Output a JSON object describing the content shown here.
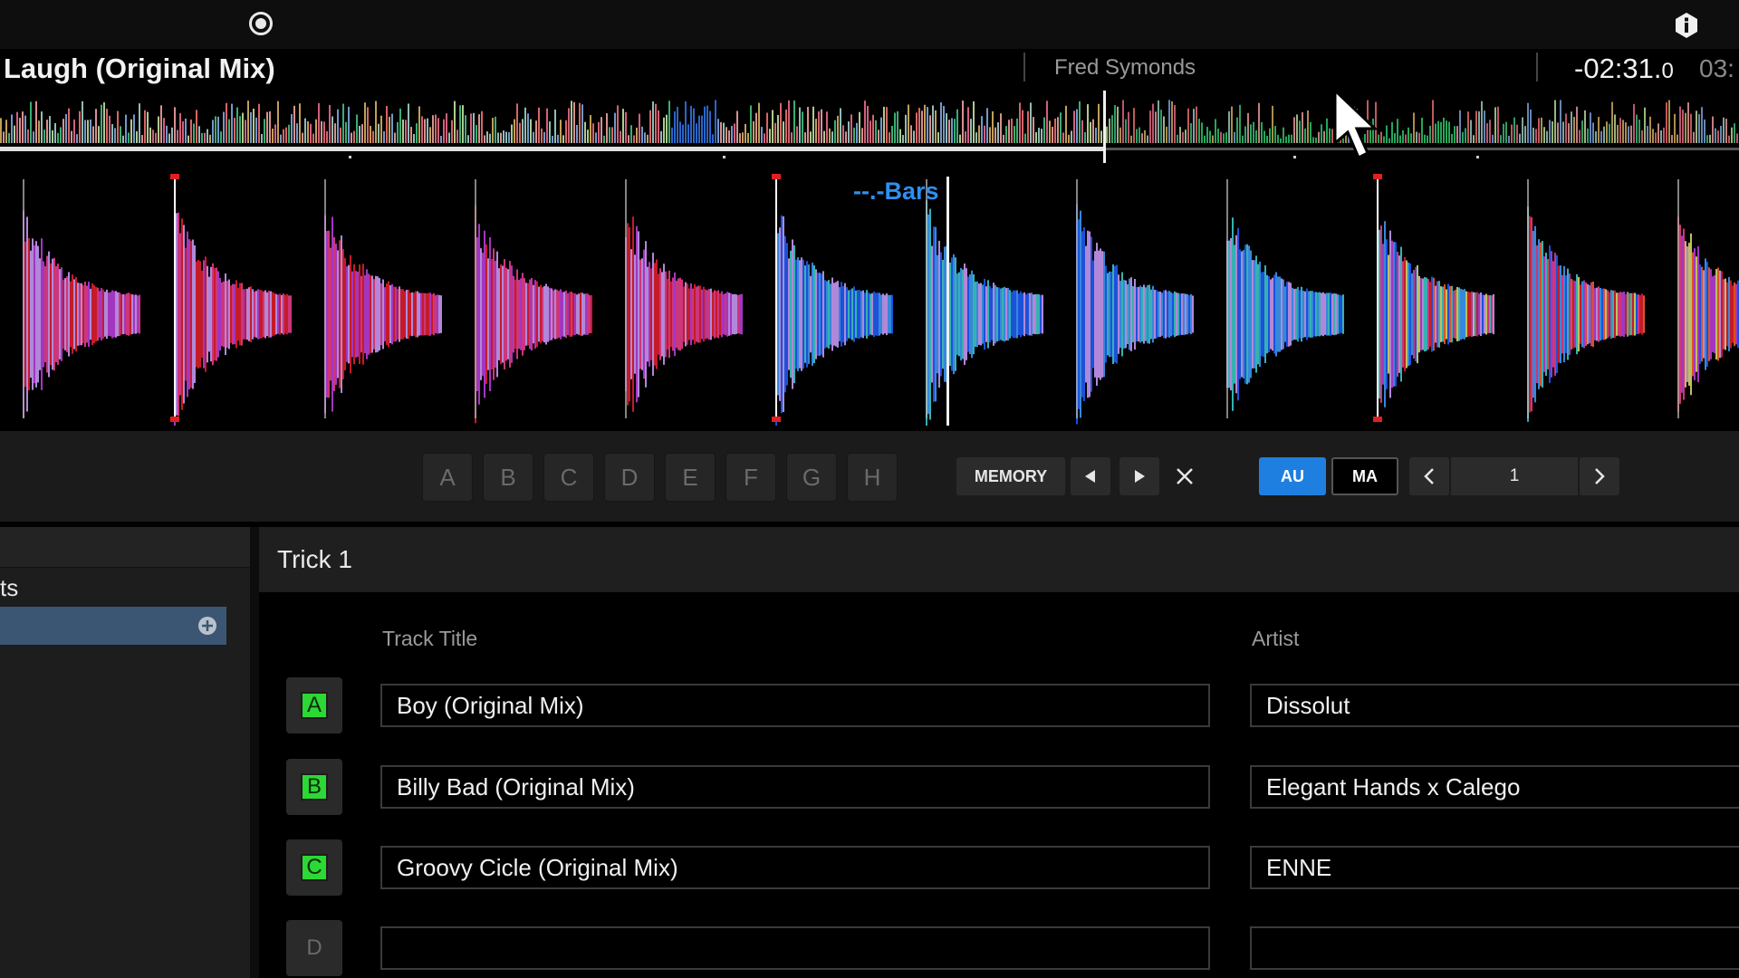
{
  "colors": {
    "accent": "#1e7fe0",
    "bars": "#2f8ff0",
    "slot_on": "#2cd834"
  },
  "icons": {
    "record": "record-icon",
    "info": "info-icon",
    "add": "plus-circle-icon"
  },
  "deck": {
    "title": "Laugh (Original Mix)",
    "artist": "Fred Symonds",
    "remaining_main": "-02:31.",
    "remaining_small": "0",
    "total": "03:",
    "bars_label": "--.-Bars"
  },
  "hotcues": [
    "A",
    "B",
    "C",
    "D",
    "E",
    "F",
    "G",
    "H"
  ],
  "controls": {
    "memory_label": "MEMORY",
    "au_label": "AU",
    "ma_label": "MA",
    "page": "1"
  },
  "left_panel": {
    "label": "ts"
  },
  "panel": {
    "title": "Trick 1",
    "col_title": "Track Title",
    "col_artist": "Artist",
    "rows": [
      {
        "slot": "A",
        "title": "Boy (Original Mix)",
        "artist": "Dissolut",
        "active": true
      },
      {
        "slot": "B",
        "title": "Billy Bad (Original Mix)",
        "artist": "Elegant Hands x Calego",
        "active": true
      },
      {
        "slot": "C",
        "title": "Groovy Cicle (Original Mix)",
        "artist": "ENNE",
        "active": true
      },
      {
        "slot": "D",
        "title": "",
        "artist": "",
        "active": false
      }
    ]
  }
}
